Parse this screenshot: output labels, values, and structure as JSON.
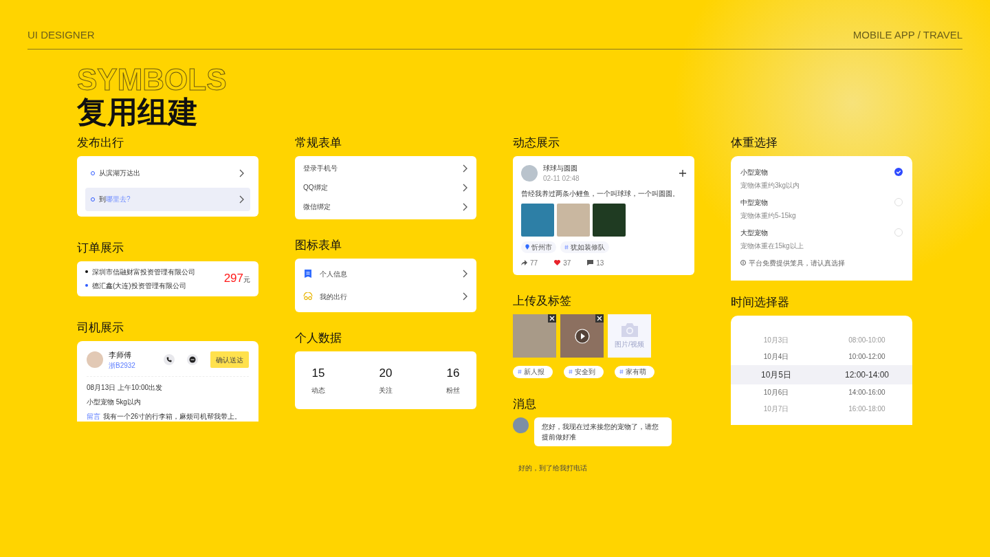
{
  "header": {
    "left": "UI DESIGNER",
    "right": "MOBILE APP / TRAVEL"
  },
  "title": "复用组建",
  "title_outline": "SYMBOLS",
  "columns": [
    [
      {
        "kind": "route",
        "heading": "发布出行",
        "items": [
          {
            "prefix": "从滨湖万达出",
            "active": false
          },
          {
            "prefix": "到",
            "accent": "哪里去?",
            "active": true
          }
        ]
      },
      {
        "kind": "order",
        "heading": "订单展示",
        "lines": [
          {
            "text": "深圳市信融财富投资管理有限公司",
            "color": "#111111"
          },
          {
            "text": "德汇鑫(大连)投资管理有限公司",
            "color": "#2f5bff"
          }
        ],
        "price": "297",
        "unit": "元"
      },
      {
        "kind": "driver",
        "heading": "司机展示",
        "name": "李师傅",
        "plate": "浙B2932",
        "button": "确认送达",
        "lines": [
          "08月13日 上午10:00出发",
          "小型宠物 5kg以内"
        ],
        "note_label": "留言",
        "note": "我有一个26寸的行李箱，麻烦司机帮我带上。"
      }
    ],
    [
      {
        "kind": "list",
        "heading": "常规表单",
        "items": [
          "登录手机号",
          "QQ绑定",
          "微信绑定"
        ]
      },
      {
        "kind": "icon_list",
        "heading": "图标表单",
        "items": [
          {
            "kind": "document",
            "text": "个人信息"
          },
          {
            "kind": "glasses",
            "text": "我的出行"
          }
        ]
      },
      {
        "kind": "stats",
        "heading": "个人数据",
        "items": [
          {
            "value": "15",
            "label": "动态"
          },
          {
            "value": "20",
            "label": "关注"
          },
          {
            "value": "16",
            "label": "粉丝"
          }
        ]
      }
    ],
    [
      {
        "kind": "feed",
        "heading": "动态展示",
        "user": "球球与圆圆",
        "time": "02-11 02:48",
        "text": "曾经我养过两条小鲤鱼，一个叫球球，一个叫圆圆。",
        "tags": [
          {
            "kind": "location",
            "text": "忻州市"
          },
          {
            "kind": "topic",
            "text": "犹如装修队"
          }
        ],
        "actions": [
          {
            "kind": "share",
            "count": "77"
          },
          {
            "kind": "like",
            "count": "37"
          },
          {
            "kind": "comment",
            "count": "13"
          }
        ]
      },
      {
        "kind": "upload",
        "heading": "上传及标签",
        "items": [
          {
            "kind": "photo"
          },
          {
            "kind": "video"
          },
          {
            "kind": "add",
            "label": "图片/视频"
          }
        ],
        "tags": [
          "新人报",
          "安全到",
          "家有萌"
        ]
      },
      {
        "kind": "message",
        "heading": "消息",
        "incoming": "您好，我现在过来接您的宠物了，请您提前做好准",
        "reply": "好的，到了给我打电话"
      }
    ],
    [
      {
        "kind": "weight",
        "heading": "体重选择",
        "options": [
          {
            "title": "小型宠物",
            "desc": "宠物体重约3kg以内",
            "selected": true
          },
          {
            "title": "中型宠物",
            "desc": "宠物体重约5-15kg",
            "selected": false
          },
          {
            "title": "大型宠物",
            "desc": "宠物体重在15kg以上",
            "selected": false
          }
        ],
        "note": "平台免费提供笼具，请认真选择"
      },
      {
        "kind": "picker",
        "heading": "时间选择器",
        "rows": [
          {
            "date": "10月3日",
            "time": "08:00-10:00",
            "selected": false
          },
          {
            "date": "10月4日",
            "time": "10:00-12:00",
            "selected": false
          },
          {
            "date": "10月5日",
            "time": "12:00-14:00",
            "selected": true
          },
          {
            "date": "10月6日",
            "time": "14:00-16:00",
            "selected": false
          },
          {
            "date": "10月7日",
            "time": "16:00-18:00",
            "selected": false
          }
        ]
      }
    ]
  ]
}
